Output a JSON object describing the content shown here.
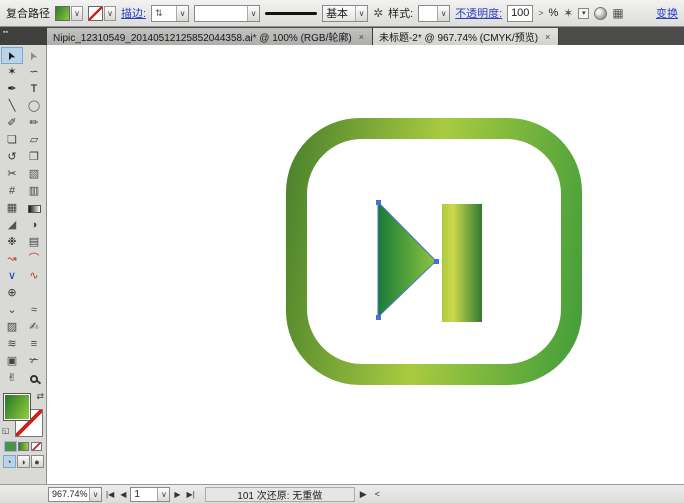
{
  "control_bar": {
    "selection_label": "复合路径",
    "stroke_link": "描边:",
    "weight_stepper_glyph": "⇅",
    "brush_label": "基本",
    "brush_options_glyph": "✲",
    "style_label": "样式:",
    "opacity_link": "不透明度:",
    "opacity_value": "100",
    "opacity_step_glyph": ">",
    "opacity_unit": "%",
    "select_similar_glyph": "✶",
    "align_glyph": "▦",
    "transform_link": "变换",
    "dropdown_glyph": "∨"
  },
  "tab_bar": {
    "corner_glyph": "▪▪",
    "tabs": [
      {
        "label": "Nipic_12310549_20140512125852044358.ai*  @  100%  (RGB/轮廓)",
        "close": "×"
      },
      {
        "label": "未标题-2*  @  967.74% (CMYK/预览)",
        "close": "×"
      }
    ]
  },
  "toolbox": {
    "tools": [
      {
        "name": "selection-tool",
        "glyph": "➤",
        "color": "#111",
        "rotate": -115,
        "active": true
      },
      {
        "name": "direct-selection-tool",
        "glyph": "➤",
        "color": "#8a8a88",
        "rotate": -115
      },
      {
        "name": "magic-wand-tool",
        "glyph": "✶",
        "color": "#333"
      },
      {
        "name": "lasso-tool",
        "glyph": "∽",
        "color": "#333"
      },
      {
        "name": "pen-tool",
        "glyph": "✒",
        "color": "#222"
      },
      {
        "name": "type-tool",
        "glyph": "T",
        "color": "#111"
      },
      {
        "name": "line-segment-tool",
        "glyph": "╲",
        "color": "#333"
      },
      {
        "name": "ellipse-tool",
        "glyph": "◯",
        "color": "#555"
      },
      {
        "name": "paintbrush-tool",
        "glyph": "✐",
        "color": "#333"
      },
      {
        "name": "pencil-tool",
        "glyph": "✏",
        "color": "#333"
      },
      {
        "name": "flip-page-tool",
        "glyph": "❏",
        "color": "#444"
      },
      {
        "name": "eraser-tool",
        "glyph": "▱",
        "color": "#444"
      },
      {
        "name": "rotate-tool",
        "glyph": "↺",
        "color": "#333"
      },
      {
        "name": "artboards-tool",
        "glyph": "❐",
        "color": "#444"
      },
      {
        "name": "scissors-tool",
        "glyph": "✂",
        "color": "#333"
      },
      {
        "name": "selection-marquee-tool",
        "glyph": "▧",
        "color": "#555"
      },
      {
        "name": "perspective-tool",
        "glyph": "#",
        "color": "#444"
      },
      {
        "name": "building-graph-tool",
        "glyph": "▥",
        "color": "#444"
      },
      {
        "name": "mesh-tool",
        "glyph": "▦",
        "color": "#444"
      },
      {
        "name": "gradient-tool",
        "glyph": "",
        "color": "#444",
        "chip": "gradient"
      },
      {
        "name": "eyedropper-tool",
        "glyph": "◢",
        "color": "#555"
      },
      {
        "name": "blend-tool",
        "glyph": "◑",
        "color": "#444"
      },
      {
        "name": "symbol-sprayer-tool",
        "glyph": "❉",
        "color": "#333"
      },
      {
        "name": "column-graph-tool",
        "glyph": "▤",
        "color": "#444"
      },
      {
        "name": "warp-arrow-tool",
        "glyph": "↝",
        "color": "#c0392b"
      },
      {
        "name": "arc-tool",
        "glyph": "⌒",
        "color": "#c0392b"
      },
      {
        "name": "polyline-tool",
        "glyph": "∨",
        "color": "#1a3fb0"
      },
      {
        "name": "wave-tool",
        "glyph": "∿",
        "color": "#c0392b"
      },
      {
        "name": "target-tool",
        "glyph": "⊕",
        "color": "#333"
      },
      {
        "name": "empty-cell",
        "glyph": ""
      },
      {
        "name": "warp-tool",
        "glyph": "⌄",
        "color": "#444"
      },
      {
        "name": "ribbon-tool",
        "glyph": "≈",
        "color": "#444"
      },
      {
        "name": "chart-tool",
        "glyph": "▨",
        "color": "#444"
      },
      {
        "name": "annotate-tool",
        "glyph": "✍",
        "color": "#444"
      },
      {
        "name": "squiggle-tool",
        "glyph": "≋",
        "color": "#444"
      },
      {
        "name": "lines-tool",
        "glyph": "≡",
        "color": "#444"
      },
      {
        "name": "frame-tool",
        "glyph": "▣",
        "color": "#444"
      },
      {
        "name": "knife-tool",
        "glyph": "✃",
        "color": "#333"
      },
      {
        "name": "hand-tool",
        "glyph": "✌",
        "color": "#333"
      },
      {
        "name": "zoom-tool",
        "glyph": "",
        "color": "#333",
        "chip": "magnifier"
      }
    ],
    "swap_glyph": "⇄",
    "default_glyph": "◱",
    "mode_buttons": [
      "◔",
      "◑",
      "●"
    ]
  },
  "status_bar": {
    "zoom_value": "967.74%",
    "nav_first": "|◀",
    "nav_prev": "◀",
    "page_value": "1",
    "nav_next": "▶",
    "nav_last": "▶|",
    "status_text": "101 次还原: 无重做",
    "flyout_glyph": "▶",
    "handle_glyph": "<",
    "dropdown_glyph": "∨"
  },
  "artwork": {
    "colors": {
      "ring-left": "#47802b",
      "ring-mid": "#a9cb40",
      "ring-right": "#3f9c3a",
      "tri-dark": "#187c38",
      "tri-light": "#90c63e",
      "bar-light": "#aeca3e",
      "bar-mid": "#ccd84e",
      "bar-dark": "#2e7a2f",
      "selection-blue": "#4a6fd4"
    }
  }
}
